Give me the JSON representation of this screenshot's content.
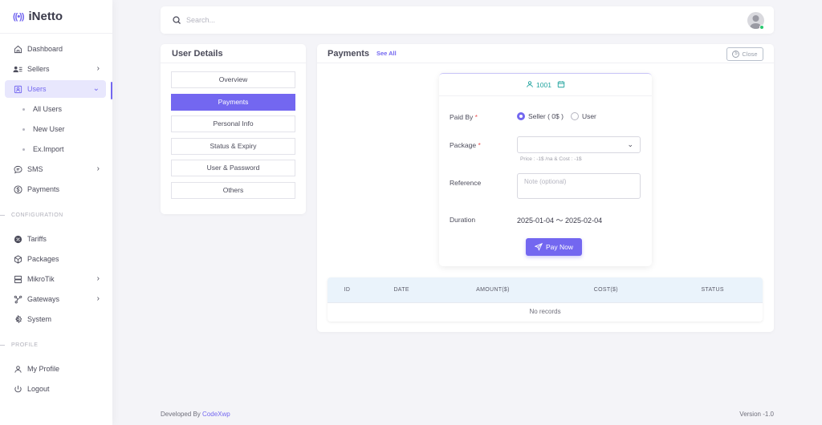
{
  "brand": {
    "name": "iNetto",
    "logo_icon": "broadcast-icon",
    "accent": "#7367f0"
  },
  "sidebar": {
    "items": [
      {
        "label": "Dashboard",
        "icon": "home-icon"
      },
      {
        "label": "Sellers",
        "icon": "users-list-icon",
        "has_children": true
      },
      {
        "label": "Users",
        "icon": "user-square-icon",
        "has_children": true,
        "active": true,
        "expanded": true,
        "children": [
          {
            "label": "All Users"
          },
          {
            "label": "New User"
          },
          {
            "label": "Ex.Import"
          }
        ]
      },
      {
        "label": "SMS",
        "icon": "message-icon",
        "has_children": true
      },
      {
        "label": "Payments",
        "icon": "dollar-circle-icon"
      }
    ],
    "config_label": "CONFIGURATION",
    "config_items": [
      {
        "label": "Tariffs",
        "icon": "discount-icon"
      },
      {
        "label": "Packages",
        "icon": "box-icon"
      },
      {
        "label": "MikroTik",
        "icon": "server-icon",
        "has_children": true
      },
      {
        "label": "Gateways",
        "icon": "network-icon",
        "has_children": true
      },
      {
        "label": "System",
        "icon": "gear-icon"
      }
    ],
    "profile_label": "PROFILE",
    "profile_items": [
      {
        "label": "My Profile",
        "icon": "user-icon"
      },
      {
        "label": "Logout",
        "icon": "power-icon"
      }
    ]
  },
  "topbar": {
    "search_placeholder": "Search...",
    "avatar_status": "online"
  },
  "user_details": {
    "title": "User Details",
    "tabs": [
      {
        "label": "Overview"
      },
      {
        "label": "Payments",
        "active": true
      },
      {
        "label": "Personal Info"
      },
      {
        "label": "Status & Expiry"
      },
      {
        "label": "User & Password"
      },
      {
        "label": "Others"
      }
    ]
  },
  "payments": {
    "title": "Payments",
    "see_all": "See All",
    "close_label": "Close",
    "form": {
      "user_id": "1001",
      "paid_by_label": "Paid By",
      "paid_by_options": [
        {
          "label": "Seller ( 0$ )",
          "checked": true
        },
        {
          "label": "User",
          "checked": false
        }
      ],
      "package_label": "Package",
      "package_value": "",
      "package_hint": "Price : -1$ /na & Cost : -1$",
      "reference_label": "Reference",
      "reference_placeholder": "Note (optional)",
      "duration_label": "Duration",
      "duration_value": "2025-01-04 〜 2025-02-04",
      "required_mark": "*",
      "pay_button": "Pay Now"
    },
    "table": {
      "columns": [
        "ID",
        "DATE",
        "AMOUNT($)",
        "COST($)",
        "STATUS"
      ],
      "rows": [],
      "empty_text": "No records"
    }
  },
  "footer": {
    "developed_by": "Developed By",
    "developer": "CodeXwp",
    "version": "Version -1.0"
  }
}
